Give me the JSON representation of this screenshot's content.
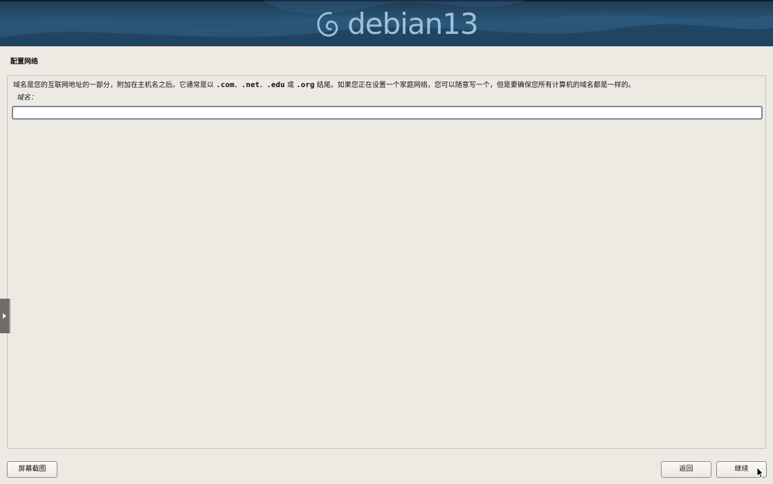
{
  "banner": {
    "logo_text": "debian13",
    "logo_icon": "debian-swirl-icon"
  },
  "page": {
    "title": "配置网络"
  },
  "form": {
    "description_prefix": "域名是您的互联网地址的一部分，附加在主机名之后。它通常是以 ",
    "tld_com": ".com",
    "sep1": "、",
    "tld_net": ".net",
    "sep2": "、",
    "tld_edu": ".edu",
    "or_word": " 或 ",
    "tld_org": ".org",
    "description_suffix": " 结尾。如果您正在设置一个家庭网络，您可以随意写一个，但是要确保您所有计算机的域名都是一样的。",
    "field_label": "域名：",
    "domain_value": ""
  },
  "side_handle": {
    "icon": "expand-arrow-icon"
  },
  "buttons": {
    "screenshot_label": "屏幕截图",
    "back_label": "返回",
    "continue_label": "继续"
  },
  "colors": {
    "banner_dark": "#1d3a52",
    "banner_mid": "#2a5577",
    "logo": "#9fc0d8",
    "background": "#edeae4"
  }
}
